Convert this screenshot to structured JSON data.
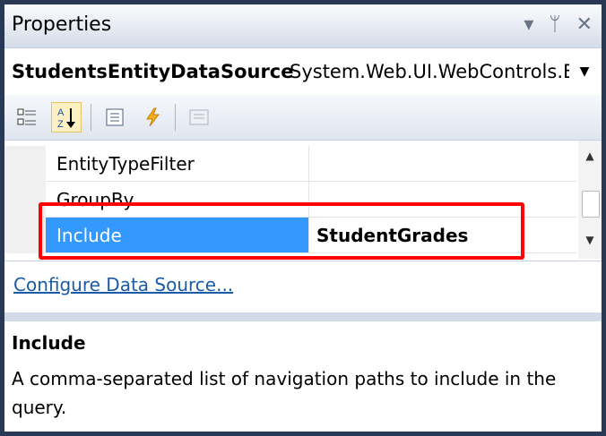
{
  "window": {
    "title": "Properties",
    "title_icons": [
      "dropdown-icon",
      "pin-icon",
      "close-icon"
    ]
  },
  "object_selector": {
    "name": "StudentsEntityDataSource",
    "type": "System.Web.UI.WebControls.E"
  },
  "toolbar": {
    "buttons": [
      {
        "name": "categorized-icon",
        "active": false
      },
      {
        "name": "alphabetical-icon",
        "active": true
      },
      {
        "name": "properties-icon",
        "active": false
      },
      {
        "name": "events-icon",
        "active": false
      },
      {
        "name": "property-pages-icon",
        "active": false
      }
    ]
  },
  "grid": {
    "rows": [
      {
        "name": "EntityTypeFilter",
        "value": ""
      },
      {
        "name": "GroupBy",
        "value": ""
      },
      {
        "name": "Include",
        "value": "StudentGrades",
        "selected": true
      }
    ]
  },
  "commands": {
    "configure_link": "Configure Data Source..."
  },
  "description": {
    "heading": "Include",
    "text": "A comma-separated list of navigation paths to include in the query."
  },
  "colors": {
    "selection": "#3399ff",
    "highlight_box": "#ff0000",
    "frame": "#293955"
  }
}
